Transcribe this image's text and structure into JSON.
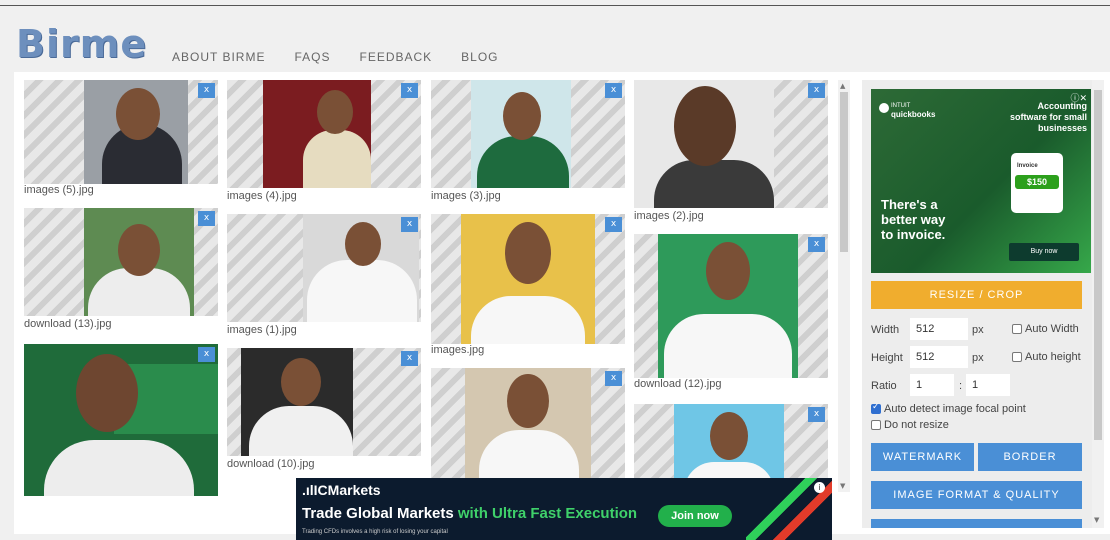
{
  "header": {
    "logo": "Birme",
    "nav": [
      "ABOUT BIRME",
      "FAQS",
      "FEEDBACK",
      "BLOG"
    ]
  },
  "gallery": {
    "close_label": "x",
    "files": [
      "images (5).jpg",
      "images (4).jpg",
      "images (3).jpg",
      "images (2).jpg",
      "download (13).jpg",
      "images (1).jpg",
      "images.jpg",
      "download (12).jpg",
      "download (10).jpg"
    ]
  },
  "sidebar": {
    "resize_button": "RESIZE / CROP",
    "width_label": "Width",
    "width_value": "512",
    "width_unit": "px",
    "auto_width": "Auto Width",
    "height_label": "Height",
    "height_value": "512",
    "height_unit": "px",
    "auto_height": "Auto height",
    "ratio_label": "Ratio",
    "ratio_a": "1",
    "ratio_sep": ":",
    "ratio_b": "1",
    "auto_detect": "Auto detect image focal point",
    "auto_detect_checked": true,
    "do_not_resize": "Do not resize",
    "watermark": "WATERMARK",
    "border": "BORDER",
    "format_quality": "IMAGE FORMAT & QUALITY"
  },
  "ad_square": {
    "brand_top": "INTUIT",
    "brand": "quickbooks",
    "tagline": "Accounting software for small businesses",
    "invoice_label": "Invoice",
    "amount": "$150",
    "headline": "There's a better way to invoice.",
    "cta": "Buy now"
  },
  "ad_bottom": {
    "brand": ".ılICMarkets",
    "headline_a": "Trade Global Markets ",
    "headline_b": "with Ultra Fast Execution",
    "cta": "Join now",
    "disclaimer": "Trading CFDs involves a high risk of losing your capital"
  },
  "colors": {
    "accent_blue": "#4a8fd6",
    "resize_orange": "#f0ad2e",
    "logo_blue": "#6d8fbd"
  }
}
